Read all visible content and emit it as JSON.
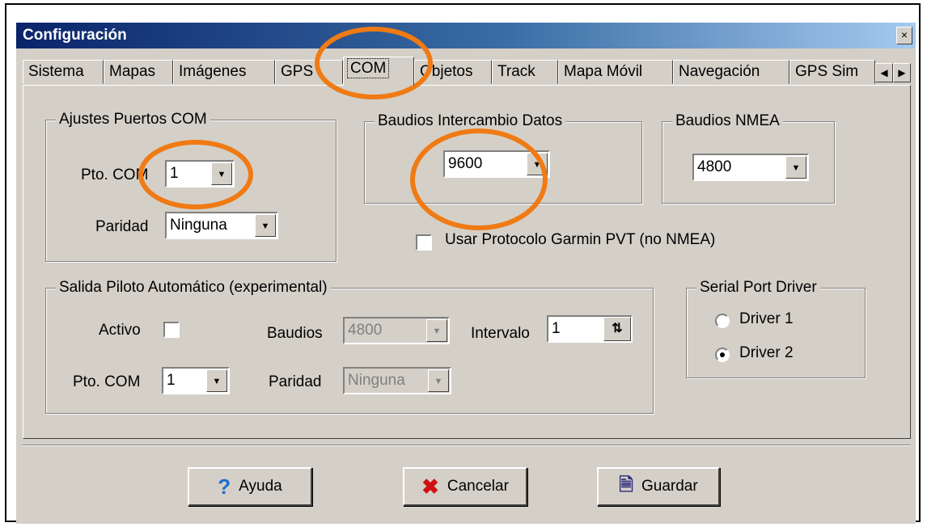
{
  "window": {
    "title": "Configuración",
    "close_label": "×"
  },
  "tabs": [
    {
      "label": "Sistema"
    },
    {
      "label": "Mapas"
    },
    {
      "label": "Imágenes"
    },
    {
      "label": "GPS"
    },
    {
      "label": "COM"
    },
    {
      "label": "Objetos"
    },
    {
      "label": "Track"
    },
    {
      "label": "Mapa Móvil"
    },
    {
      "label": "Navegación"
    },
    {
      "label": "GPS Sim"
    }
  ],
  "tab_scroll": {
    "left": "◀",
    "right": "▶"
  },
  "ajustes": {
    "title": "Ajustes Puertos COM",
    "pto_label": "Pto. COM",
    "pto_value": "1",
    "paridad_label": "Paridad",
    "paridad_value": "Ninguna"
  },
  "baudios_datos": {
    "title": "Baudios Intercambio Datos",
    "value": "9600"
  },
  "baudios_nmea": {
    "title": "Baudios NMEA",
    "value": "4800"
  },
  "garmin": {
    "label": "Usar Protocolo Garmin PVT (no NMEA)"
  },
  "piloto": {
    "title": "Salida Piloto Automático (experimental)",
    "activo_label": "Activo",
    "baudios_label": "Baudios",
    "baudios_value": "4800",
    "intervalo_label": "Intervalo",
    "intervalo_value": "1",
    "pto_label": "Pto. COM",
    "pto_value": "1",
    "paridad_label": "Paridad",
    "paridad_value": "Ninguna"
  },
  "serial_driver": {
    "title": "Serial Port Driver",
    "options": [
      {
        "label": "Driver 1",
        "checked": false
      },
      {
        "label": "Driver 2",
        "checked": true
      }
    ]
  },
  "buttons": {
    "ayuda": "Ayuda",
    "cancelar": "Cancelar",
    "guardar": "Guardar"
  },
  "colors": {
    "title_gradient_start": "#0a246a",
    "title_gradient_end": "#a6caf0",
    "highlight_ellipse": "#f07a14",
    "face": "#d4d0c8"
  },
  "icons": {
    "help": "help-question-icon",
    "cancel": "cancel-x-icon",
    "save": "save-document-icon"
  }
}
